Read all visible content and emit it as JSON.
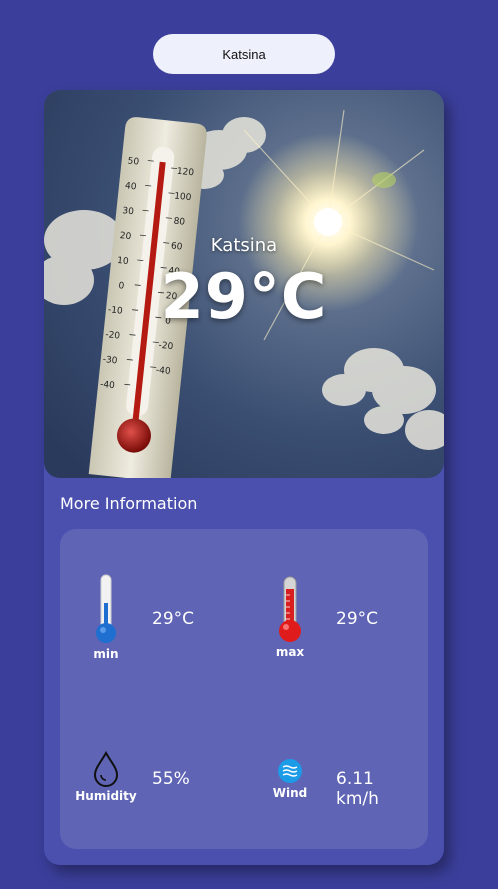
{
  "search": {
    "value": "Katsina"
  },
  "hero": {
    "city": "Katsina",
    "temperature": "29°C"
  },
  "more_info": {
    "title": "More Information",
    "min": {
      "label": "min",
      "value": "29°C"
    },
    "max": {
      "label": "max",
      "value": "29°C"
    },
    "humidity": {
      "label": "Humidity",
      "value": "55%"
    },
    "wind": {
      "label": "Wind",
      "value": "6.11 km/h"
    }
  },
  "colors": {
    "background": "#3b3f9b",
    "card": "#4b4fae",
    "panel": "#5f64b5"
  },
  "icons": {
    "min": "thermometer-cold-icon",
    "max": "thermometer-hot-icon",
    "humidity": "water-drop-icon",
    "wind": "wind-icon"
  }
}
